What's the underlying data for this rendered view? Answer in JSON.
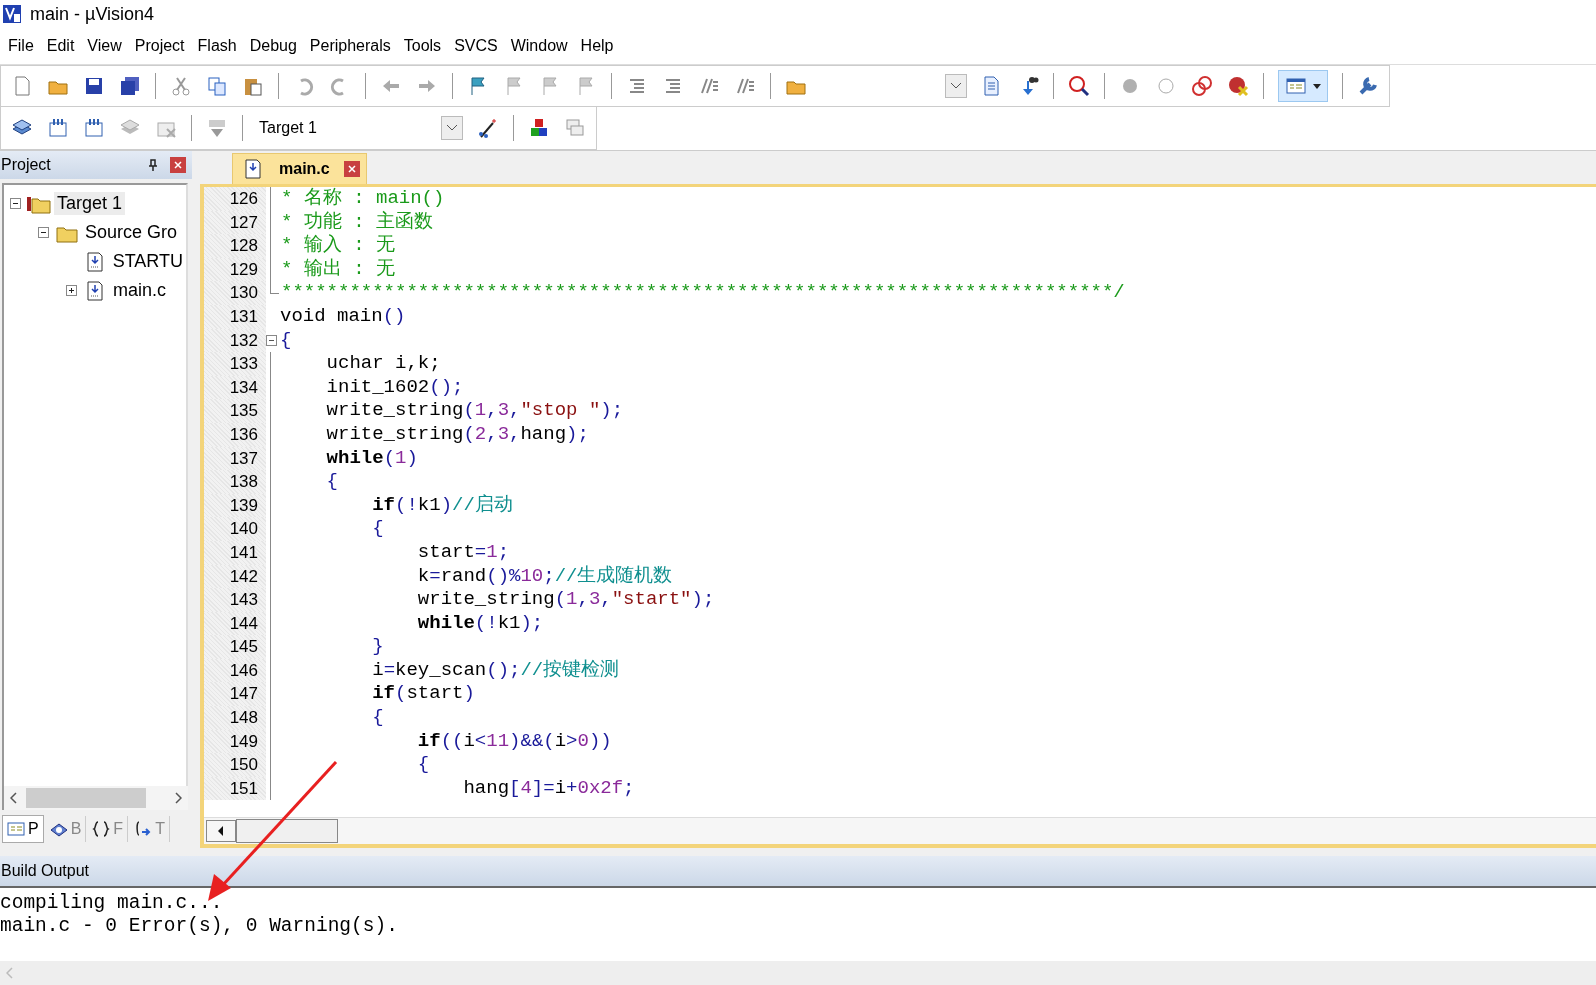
{
  "window": {
    "title": "main  - µVision4"
  },
  "menu": [
    "File",
    "Edit",
    "View",
    "Project",
    "Flash",
    "Debug",
    "Peripherals",
    "Tools",
    "SVCS",
    "Window",
    "Help"
  ],
  "toolbar": {
    "target_select": "Target 1"
  },
  "project": {
    "title": "Project",
    "tree": [
      {
        "label": "Target 1",
        "kind": "target",
        "expanded": true,
        "selected": true,
        "children": [
          {
            "label": "Source Gro",
            "kind": "group",
            "expanded": true,
            "selected": false,
            "children": [
              {
                "label": "STARTU",
                "kind": "file",
                "selected": false
              },
              {
                "label": "main.c",
                "kind": "file",
                "expanded": false,
                "selected": false
              }
            ]
          }
        ]
      }
    ],
    "tabs": [
      {
        "label": "P",
        "selected": true
      },
      {
        "label": "B",
        "selected": false
      },
      {
        "label": "F",
        "selected": false
      },
      {
        "label": "T",
        "selected": false
      }
    ]
  },
  "editor": {
    "tab": "main.c",
    "lines": [
      {
        "number": "126",
        "kind": "body",
        "tokens": [
          {
            "kind": "hdr",
            "text": "* 名称 : main()"
          }
        ]
      },
      {
        "number": "127",
        "kind": "body",
        "tokens": [
          {
            "kind": "hdr",
            "text": "* 功能 : 主函数"
          }
        ]
      },
      {
        "number": "128",
        "kind": "body",
        "tokens": [
          {
            "kind": "hdr",
            "text": "* 输入 : 无"
          }
        ]
      },
      {
        "number": "129",
        "kind": "body",
        "tokens": [
          {
            "kind": "hdr",
            "text": "* 输出 : 无"
          }
        ]
      },
      {
        "number": "130",
        "kind": "end",
        "tokens": [
          {
            "kind": "hdr",
            "text": "*************************************************************************/"
          }
        ]
      },
      {
        "number": "131",
        "kind": "plain",
        "tokens": [
          {
            "kind": "plain",
            "text": "void main"
          },
          {
            "kind": "op",
            "text": "()"
          }
        ]
      },
      {
        "number": "132",
        "kind": "start",
        "tokens": [
          {
            "kind": "op",
            "text": "{"
          }
        ]
      },
      {
        "number": "133",
        "kind": "body",
        "tokens": [
          {
            "kind": "plain",
            "text": "    uchar i,k;"
          }
        ]
      },
      {
        "number": "134",
        "kind": "body",
        "tokens": [
          {
            "kind": "plain",
            "text": "    init_1602"
          },
          {
            "kind": "op",
            "text": "();"
          }
        ]
      },
      {
        "number": "135",
        "kind": "body",
        "tokens": [
          {
            "kind": "plain",
            "text": "    write_string"
          },
          {
            "kind": "op",
            "text": "("
          },
          {
            "kind": "num",
            "text": "1"
          },
          {
            "kind": "op",
            "text": ","
          },
          {
            "kind": "num",
            "text": "3"
          },
          {
            "kind": "op",
            "text": ","
          },
          {
            "kind": "str",
            "text": "\"stop \""
          },
          {
            "kind": "op",
            "text": ");"
          }
        ]
      },
      {
        "number": "136",
        "kind": "body",
        "tokens": [
          {
            "kind": "plain",
            "text": "    write_string"
          },
          {
            "kind": "op",
            "text": "("
          },
          {
            "kind": "num",
            "text": "2"
          },
          {
            "kind": "op",
            "text": ","
          },
          {
            "kind": "num",
            "text": "3"
          },
          {
            "kind": "op",
            "text": ","
          },
          {
            "kind": "plain",
            "text": "hang"
          },
          {
            "kind": "op",
            "text": ");"
          }
        ]
      },
      {
        "number": "137",
        "kind": "body",
        "tokens": [
          {
            "kind": "kw",
            "text": "    while"
          },
          {
            "kind": "op",
            "text": "("
          },
          {
            "kind": "num",
            "text": "1"
          },
          {
            "kind": "op",
            "text": ")"
          }
        ]
      },
      {
        "number": "138",
        "kind": "body",
        "tokens": [
          {
            "kind": "op",
            "text": "    {"
          }
        ]
      },
      {
        "number": "139",
        "kind": "body",
        "tokens": [
          {
            "kind": "kw",
            "text": "        if"
          },
          {
            "kind": "op",
            "text": "(!"
          },
          {
            "kind": "plain",
            "text": "k1"
          },
          {
            "kind": "op",
            "text": ")"
          },
          {
            "kind": "cmt",
            "text": "//启动"
          }
        ]
      },
      {
        "number": "140",
        "kind": "body",
        "tokens": [
          {
            "kind": "op",
            "text": "        {"
          }
        ]
      },
      {
        "number": "141",
        "kind": "body",
        "tokens": [
          {
            "kind": "plain",
            "text": "            start"
          },
          {
            "kind": "op",
            "text": "="
          },
          {
            "kind": "num",
            "text": "1"
          },
          {
            "kind": "op",
            "text": ";"
          }
        ]
      },
      {
        "number": "142",
        "kind": "body",
        "tokens": [
          {
            "kind": "plain",
            "text": "            k"
          },
          {
            "kind": "op",
            "text": "="
          },
          {
            "kind": "plain",
            "text": "rand"
          },
          {
            "kind": "op",
            "text": "()%"
          },
          {
            "kind": "num",
            "text": "10"
          },
          {
            "kind": "op",
            "text": ";"
          },
          {
            "kind": "cmt",
            "text": "//生成随机数"
          }
        ]
      },
      {
        "number": "143",
        "kind": "body",
        "tokens": [
          {
            "kind": "plain",
            "text": "            write_string"
          },
          {
            "kind": "op",
            "text": "("
          },
          {
            "kind": "num",
            "text": "1"
          },
          {
            "kind": "op",
            "text": ","
          },
          {
            "kind": "num",
            "text": "3"
          },
          {
            "kind": "op",
            "text": ","
          },
          {
            "kind": "str",
            "text": "\"start\""
          },
          {
            "kind": "op",
            "text": ");"
          }
        ]
      },
      {
        "number": "144",
        "kind": "body",
        "tokens": [
          {
            "kind": "kw",
            "text": "            while"
          },
          {
            "kind": "op",
            "text": "(!"
          },
          {
            "kind": "plain",
            "text": "k1"
          },
          {
            "kind": "op",
            "text": ");"
          }
        ]
      },
      {
        "number": "145",
        "kind": "body",
        "tokens": [
          {
            "kind": "op",
            "text": "        }"
          }
        ]
      },
      {
        "number": "146",
        "kind": "body",
        "tokens": [
          {
            "kind": "plain",
            "text": "        i"
          },
          {
            "kind": "op",
            "text": "="
          },
          {
            "kind": "plain",
            "text": "key_scan"
          },
          {
            "kind": "op",
            "text": "();"
          },
          {
            "kind": "cmt",
            "text": "//按键检测"
          }
        ]
      },
      {
        "number": "147",
        "kind": "body",
        "tokens": [
          {
            "kind": "kw",
            "text": "        if"
          },
          {
            "kind": "op",
            "text": "("
          },
          {
            "kind": "plain",
            "text": "start"
          },
          {
            "kind": "op",
            "text": ")"
          }
        ]
      },
      {
        "number": "148",
        "kind": "body",
        "tokens": [
          {
            "kind": "op",
            "text": "        {"
          }
        ]
      },
      {
        "number": "149",
        "kind": "body",
        "tokens": [
          {
            "kind": "kw",
            "text": "            if"
          },
          {
            "kind": "op",
            "text": "(("
          },
          {
            "kind": "plain",
            "text": "i"
          },
          {
            "kind": "op",
            "text": "<"
          },
          {
            "kind": "num",
            "text": "11"
          },
          {
            "kind": "op",
            "text": ")&&("
          },
          {
            "kind": "plain",
            "text": "i"
          },
          {
            "kind": "op",
            "text": ">"
          },
          {
            "kind": "num",
            "text": "0"
          },
          {
            "kind": "op",
            "text": "))"
          }
        ]
      },
      {
        "number": "150",
        "kind": "body",
        "tokens": [
          {
            "kind": "op",
            "text": "            {"
          }
        ]
      },
      {
        "number": "151",
        "kind": "body",
        "tokens": [
          {
            "kind": "plain",
            "text": "                hang"
          },
          {
            "kind": "op",
            "text": "["
          },
          {
            "kind": "num",
            "text": "4"
          },
          {
            "kind": "op",
            "text": "]="
          },
          {
            "kind": "plain",
            "text": "i"
          },
          {
            "kind": "op",
            "text": "+"
          },
          {
            "kind": "num",
            "text": "0x2f"
          },
          {
            "kind": "op",
            "text": ";"
          }
        ]
      }
    ]
  },
  "build_output": {
    "title": "Build Output",
    "lines": [
      "compiling main.c...",
      "main.c - 0 Error(s), 0 Warning(s)."
    ]
  }
}
